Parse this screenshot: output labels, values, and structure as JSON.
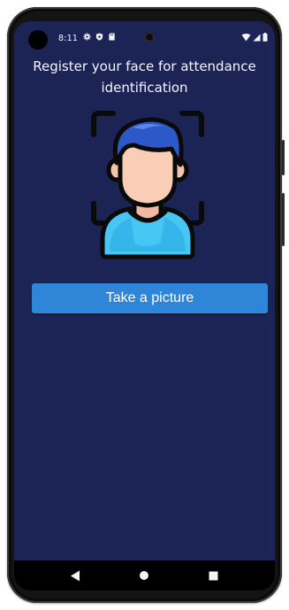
{
  "status_bar": {
    "time": "8:11",
    "left_icons": [
      "settings-icon",
      "shield-icon",
      "sd-card-icon"
    ],
    "right_icons": [
      "wifi-icon",
      "signal-icon",
      "battery-icon"
    ]
  },
  "screen": {
    "title": "Register your face for attendance identification",
    "illustration": "face-scan-icon",
    "take_picture_label": "Take a picture"
  },
  "colors": {
    "background": "#1b2455",
    "button": "#2f86d9",
    "text": "#f4f6ff"
  },
  "nav_bar": {
    "buttons": [
      "back-icon",
      "home-icon",
      "recents-icon"
    ]
  }
}
